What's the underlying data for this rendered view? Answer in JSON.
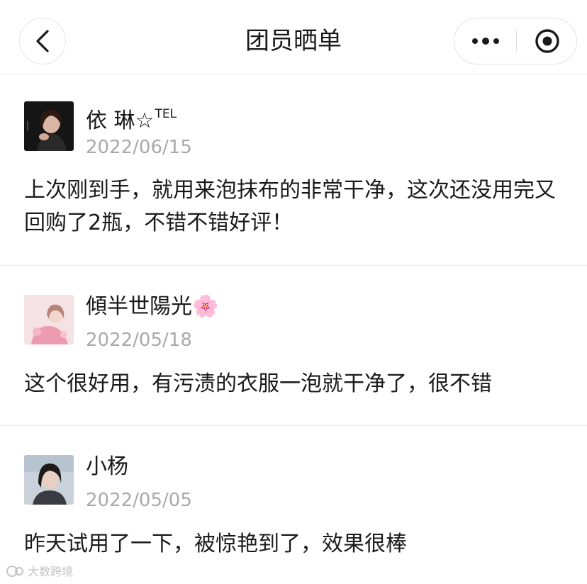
{
  "nav": {
    "title": "团员晒单",
    "back_icon": "chevron-left-icon",
    "more_icon": "more-dots-icon",
    "close_icon": "target-close-icon"
  },
  "reviews": [
    {
      "name": "依 琳☆",
      "name_sup": "TEL",
      "date": "2022/06/15",
      "text": "上次刚到手，就用来泡抹布的非常干净，这次还没用完又回购了2瓶，不错不错好评！"
    },
    {
      "name": "傾半世陽光",
      "name_emoji": "🌸",
      "date": "2022/05/18",
      "text": "这个很好用，有污渍的衣服一泡就干净了，很不错"
    },
    {
      "name": "小杨",
      "date": "2022/05/05",
      "text": "昨天试用了一下，被惊艳到了，效果很棒"
    }
  ],
  "watermark": {
    "text": "大数跨境"
  }
}
